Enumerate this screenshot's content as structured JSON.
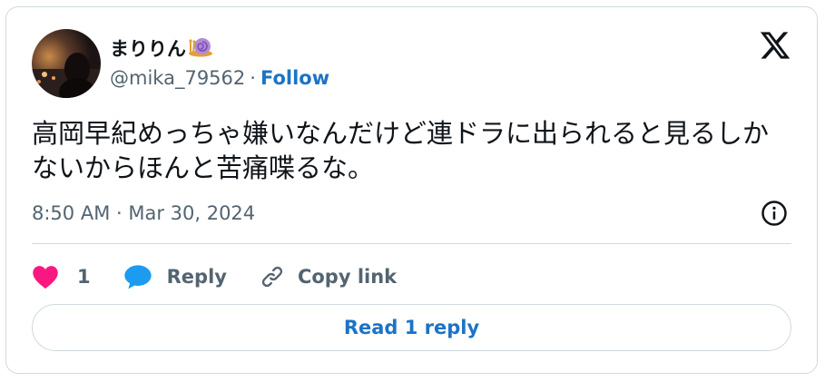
{
  "author": {
    "display_name": "まりりん",
    "display_name_emoji": "snail-emoji",
    "handle": "@mika_79562",
    "separator": "·",
    "follow_label": "Follow"
  },
  "platform_icon": "x-logo-icon",
  "tweet": {
    "text": "高岡早紀めっちゃ嫌いなんだけど連ドラに出られると見るしかないからほんと苦痛喋るな。",
    "timestamp": "8:50 AM · Mar 30, 2024"
  },
  "actions": {
    "like_icon": "heart-icon",
    "like_count": "1",
    "reply_icon": "speech-bubble-icon",
    "reply_label": "Reply",
    "copy_icon": "link-icon",
    "copy_label": "Copy link",
    "info_icon": "info-icon"
  },
  "read_replies_label": "Read 1 reply",
  "colors": {
    "accent": "#1d73c6",
    "like": "#f91880",
    "reply_icon": "#1d9bf0",
    "secondary_text": "#536471",
    "border": "#cfd9de"
  }
}
